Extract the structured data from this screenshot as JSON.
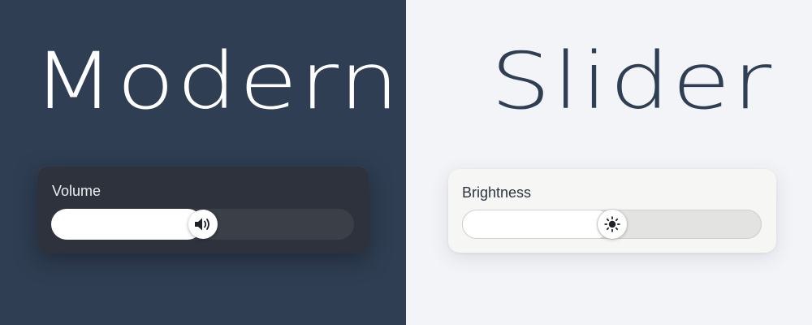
{
  "left_panel": {
    "headline": "Modern",
    "slider": {
      "label": "Volume",
      "value_fraction": 0.5,
      "icon": "speaker-icon"
    }
  },
  "right_panel": {
    "headline": "Slider",
    "slider": {
      "label": "Brightness",
      "value_fraction": 0.5,
      "icon": "sun-icon"
    }
  },
  "colors": {
    "dark_background": "#2f3e52",
    "light_background": "#f3f4f8",
    "dark_card": "#2d323c",
    "light_card": "#f6f6f5",
    "fill": "#ffffff"
  }
}
